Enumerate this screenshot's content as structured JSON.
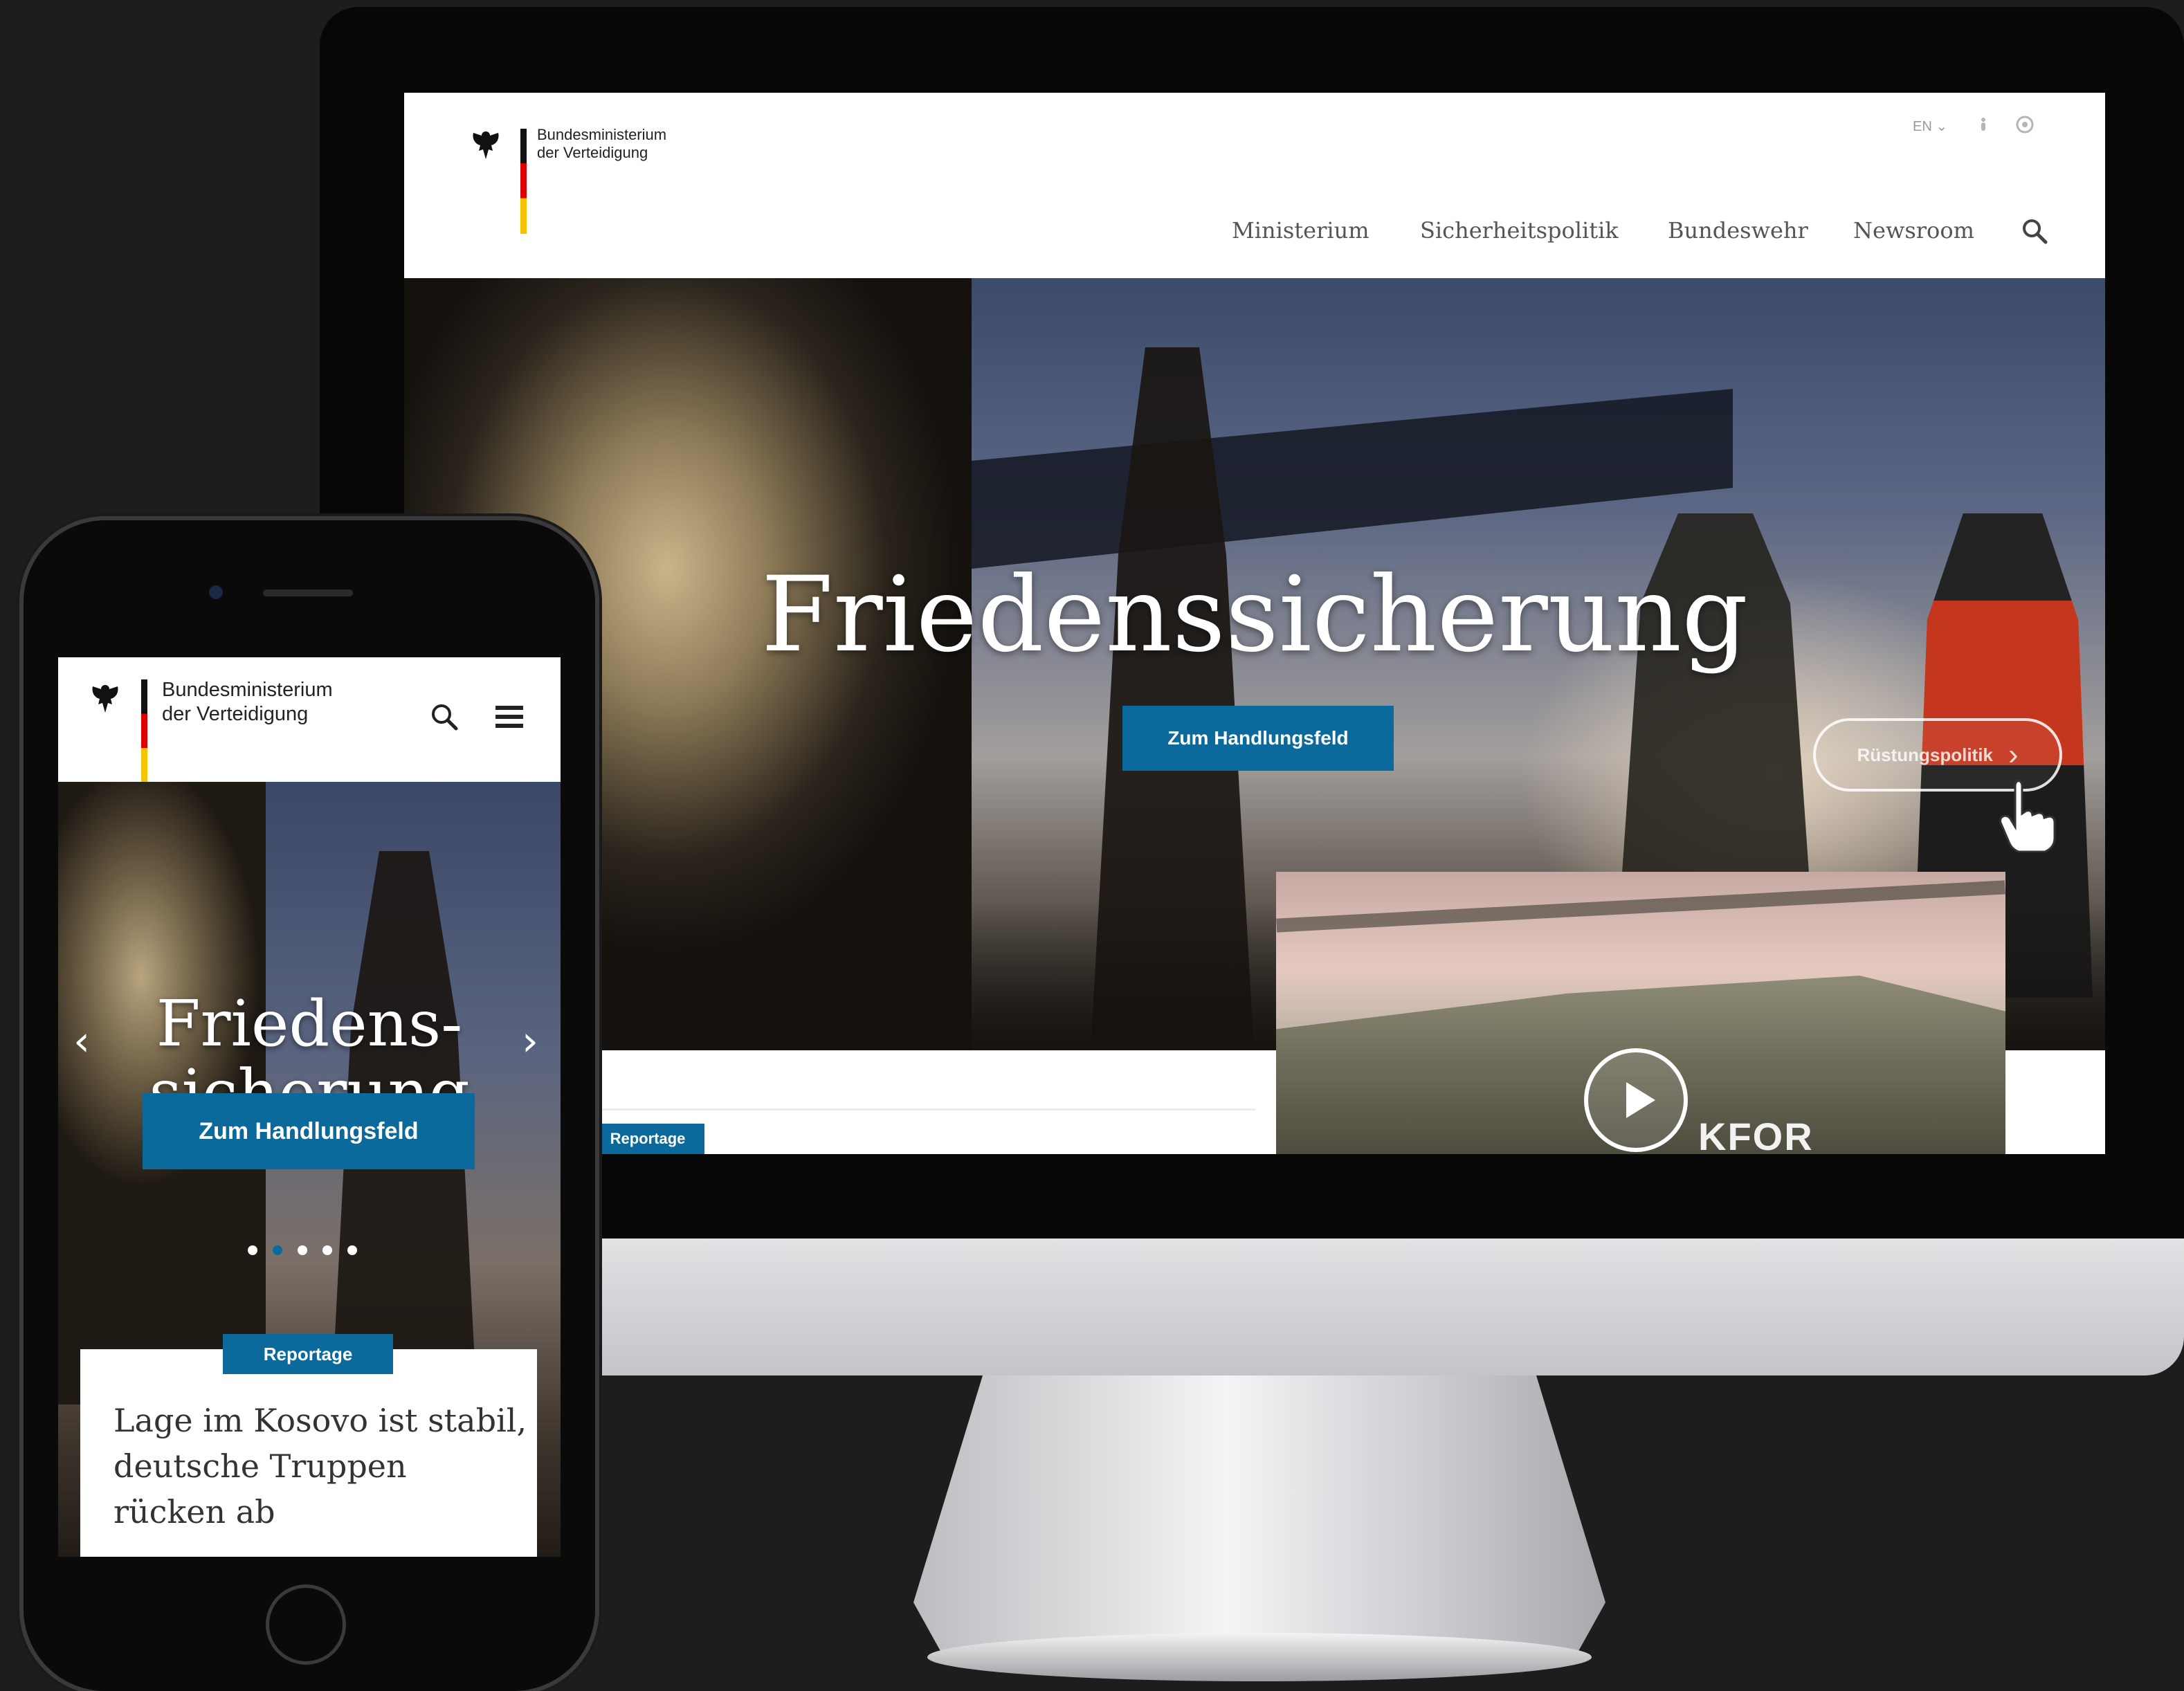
{
  "desktop": {
    "brand": {
      "line1": "Bundesministerium",
      "line2": "der Verteidigung"
    },
    "utility": {
      "language": "EN",
      "language_chevron": "chevron-down-icon",
      "icon_a": "accessibility-icon",
      "icon_b": "sign-language-icon"
    },
    "nav": [
      {
        "label": "Ministerium"
      },
      {
        "label": "Sicherheitspolitik"
      },
      {
        "label": "Bundeswehr"
      },
      {
        "label": "Newsroom"
      }
    ],
    "nav_search_icon": "search-icon",
    "hero": {
      "title": "Friedenssicherung",
      "cta": "Zum Handlungsfeld",
      "next_label": "Rüstungspolitik",
      "next_chevron": "›"
    },
    "teaser_tag": "Reportage",
    "video_text": "KFOR",
    "video_icon": "play-icon"
  },
  "mobile": {
    "brand": {
      "line1": "Bundesministerium",
      "line2": "der Verteidigung"
    },
    "hero": {
      "title_line1": "Friedens-",
      "title_line2": "sicherung",
      "cta": "Zum Handlungsfeld",
      "prev_arrow": "‹",
      "next_arrow": "›",
      "slides_total": 5,
      "slide_active": 2
    },
    "card": {
      "tag": "Reportage",
      "title": "Lage im Kosovo ist stabil, deutsche Truppen rücken ab"
    }
  },
  "colors": {
    "accent": "#0b6a9b",
    "background": "#1d1d1e"
  }
}
